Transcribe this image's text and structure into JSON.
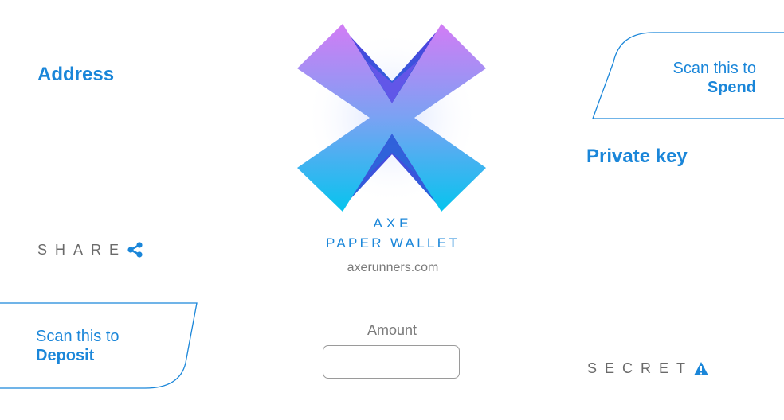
{
  "left_panel": {
    "address_label": "Address",
    "share_label": "SHARE",
    "share_icon": "share-icon",
    "deposit_card": {
      "line1": "Scan this to",
      "line2": "Deposit"
    }
  },
  "right_panel": {
    "spend_card": {
      "line1": "Scan this to",
      "line2": "Spend"
    },
    "private_key_label": "Private key",
    "secret_label": "SECRET",
    "secret_icon": "warning-icon"
  },
  "center": {
    "logo": "axe-x-logo",
    "title_line1": "AXE",
    "title_line2": "PAPER WALLET",
    "website": "axerunners.com",
    "amount_label": "Amount",
    "amount_value": ""
  },
  "colors": {
    "brand_blue": "#1a86d9",
    "logo_top": "#d27cf5",
    "logo_bottom": "#06c4ee",
    "gray_text": "#6a6a6a"
  }
}
